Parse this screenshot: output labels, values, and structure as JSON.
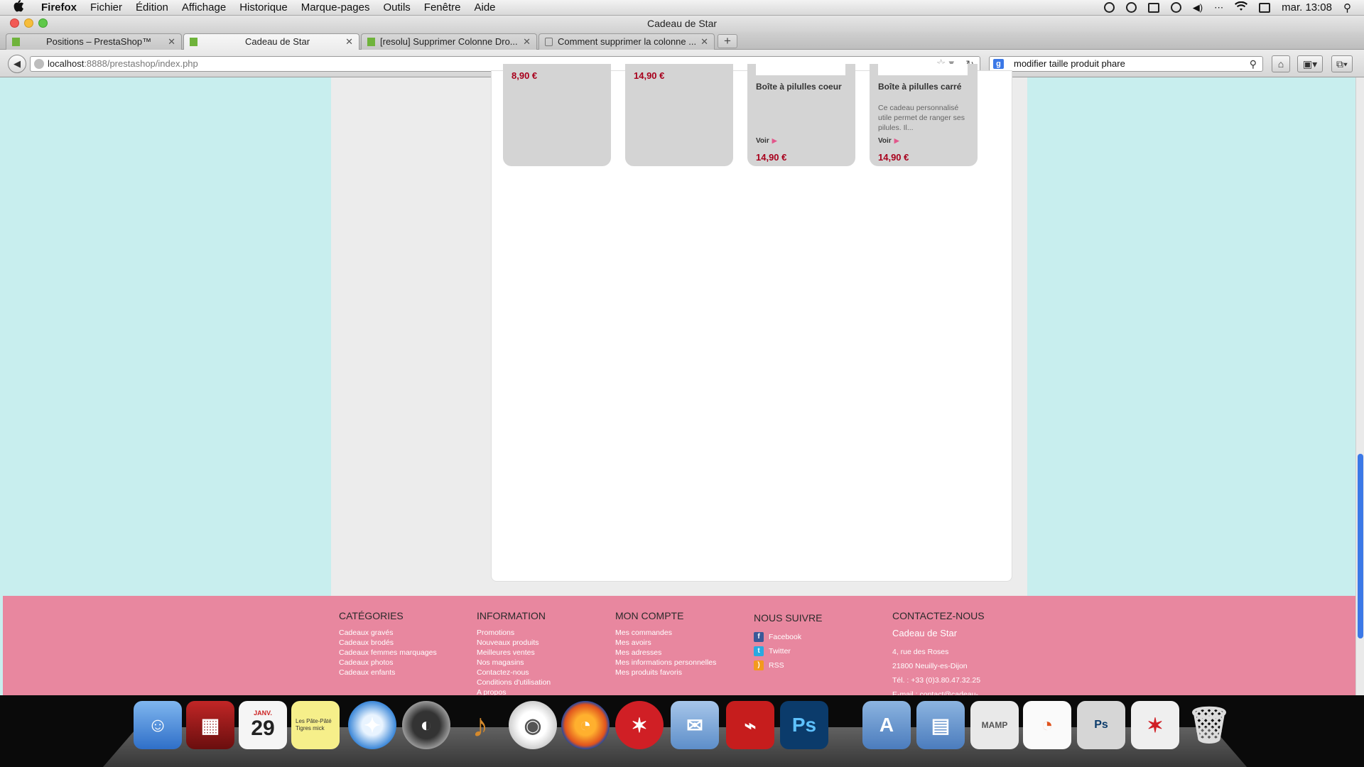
{
  "menubar": {
    "apple": "",
    "items": [
      "Firefox",
      "Fichier",
      "Édition",
      "Affichage",
      "Historique",
      "Marque-pages",
      "Outils",
      "Fenêtre",
      "Aide"
    ],
    "clock": "mar. 13:08"
  },
  "window": {
    "title": "Cadeau de Star"
  },
  "tabs": [
    {
      "label": "Positions – PrestaShop™"
    },
    {
      "label": "Cadeau de Star"
    },
    {
      "label": "[resolu] Supprimer Colonne Dro..."
    },
    {
      "label": "Comment supprimer la colonne ..."
    }
  ],
  "nav": {
    "url_host": "localhost",
    "url_rest": ":8888/prestashop/index.php",
    "search_value": "modifier taille produit phare"
  },
  "products": [
    {
      "name": "",
      "desc": "",
      "voir": "",
      "price": "8,90 €"
    },
    {
      "name": "",
      "desc": "",
      "voir": "",
      "price": "14,90 €"
    },
    {
      "name": "Boîte à pilulles coeur",
      "desc": "",
      "voir": "Voir",
      "price": "14,90 €"
    },
    {
      "name": "Boîte à pilulles carré",
      "desc": "Ce cadeau personnalisé utile permet de ranger ses pilules. Il...",
      "voir": "Voir",
      "price": "14,90 €"
    }
  ],
  "footer": {
    "categories": {
      "title": "CATÉGORIES",
      "links": [
        "Cadeaux gravés",
        "Cadeaux brodés",
        "Cadeaux femmes marquages",
        "Cadeaux photos",
        "Cadeaux enfants"
      ]
    },
    "information": {
      "title": "INFORMATION",
      "links": [
        "Promotions",
        "Nouveaux produits",
        "Meilleures ventes",
        "Nos magasins",
        "Contactez-nous",
        "Conditions d'utilisation",
        "A propos"
      ]
    },
    "account": {
      "title": "MON COMPTE",
      "links": [
        "Mes commandes",
        "Mes avoirs",
        "Mes adresses",
        "Mes informations personnelles",
        "Mes produits favoris"
      ]
    },
    "follow": {
      "title": "NOUS SUIVRE",
      "links": [
        "Facebook",
        "Twitter",
        "RSS"
      ]
    },
    "contact": {
      "title": "CONTACTEZ-NOUS",
      "name": "Cadeau de Star",
      "address": "4, rue des Roses",
      "city": "21800 Neuilly-es-Dijon",
      "phone": "Tél. : +33 (0)3.80.47.32.25",
      "email": "E-mail : contact@cadeau-"
    }
  },
  "dock": {
    "calendar_month": "JANV.",
    "calendar_day": "29",
    "stickies_text": "Les Pâte-Pâté Tigres mick"
  },
  "colors": {
    "page_bg": "#c8eeee",
    "footer_bg": "#e8879f",
    "price": "#a8001c"
  }
}
